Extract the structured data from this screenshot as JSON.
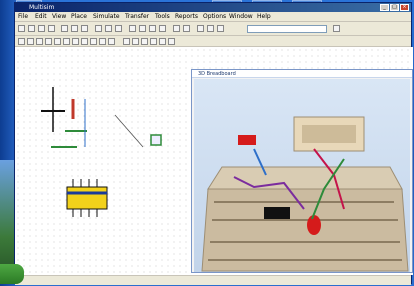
{
  "window": {
    "title": "Multisim",
    "status_left": "",
    "status_right": ""
  },
  "toolbar": {
    "items": [
      "File",
      "Edit",
      "View",
      "Place",
      "Simulate",
      "Transfer",
      "Tools",
      "Reports",
      "Options",
      "Window",
      "Help"
    ]
  },
  "breadboard": {
    "title": "3D Breadboard",
    "colors": {
      "breadboard": "#cbbba0",
      "component_red": "#d51b1b",
      "component_black": "#111111",
      "component_yellow": "#f2d11b",
      "wire_purple": "#7b2c9e",
      "wire_red": "#c4134a",
      "wire_green": "#2e8b3a"
    }
  },
  "icons": [
    "minimize-icon",
    "maximize-icon",
    "close-icon",
    "open-icon",
    "save-icon",
    "print-icon",
    "zoom-icon",
    "run-icon"
  ]
}
